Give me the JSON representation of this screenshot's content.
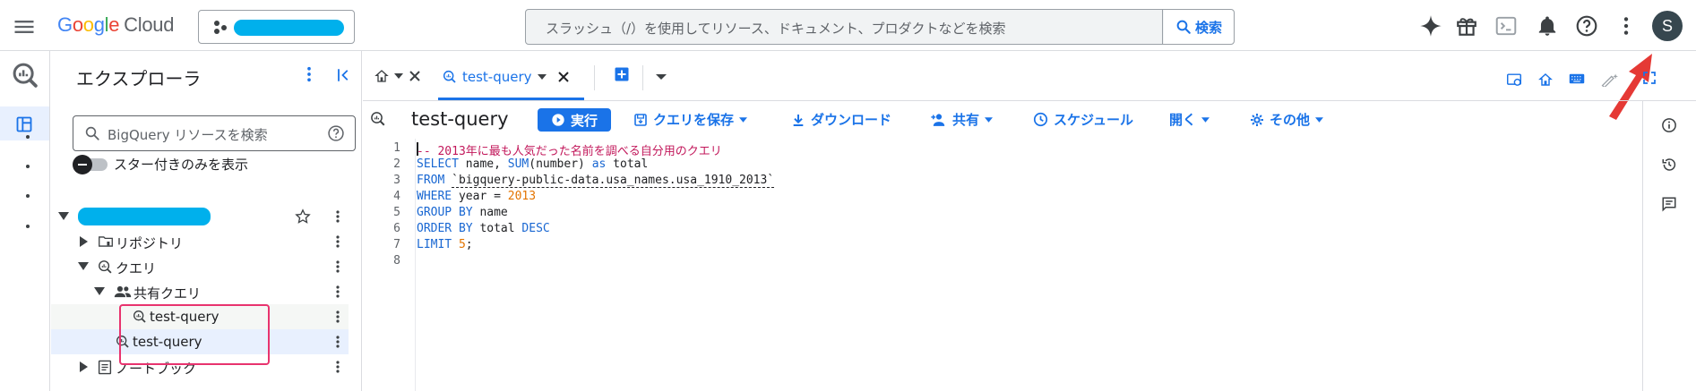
{
  "header": {
    "logo_letters": [
      "G",
      "o",
      "o",
      "g",
      "l",
      "e"
    ],
    "logo_suffix": "Cloud",
    "search_placeholder": "スラッシュ（/）を使用してリソース、ドキュメント、プロダクトなどを検索",
    "search_button": "検索",
    "avatar_initial": "S"
  },
  "explorer": {
    "title": "エクスプローラ",
    "search_placeholder": "BigQuery リソースを検索",
    "star_toggle_label": "スター付きのみを表示",
    "tree": {
      "repository": "リポジトリ",
      "queries": "クエリ",
      "shared_queries": "共有クエリ",
      "shared_query_item": "test-query",
      "query_item": "test-query",
      "notebook": "ノートブック"
    }
  },
  "tabs": {
    "active_tab": "test-query"
  },
  "query": {
    "title": "test-query",
    "run": "実行",
    "save": "クエリを保存",
    "download": "ダウンロード",
    "share": "共有",
    "schedule": "スケジュール",
    "open": "開く",
    "more": "その他"
  },
  "editor": {
    "line_numbers": [
      "1",
      "2",
      "3",
      "4",
      "5",
      "6",
      "7",
      "8"
    ],
    "lines": {
      "l1": "-- 2013年に最も人気だった名前を調べる自分用のクエリ",
      "l2_kw1": "SELECT",
      "l2_a": " name, ",
      "l2_fn": "SUM",
      "l2_b": "(number) ",
      "l2_kw2": "as",
      "l2_c": " total",
      "l3_kw": "FROM",
      "l3_sp": " ",
      "l3_str": "`bigquery-public-data.usa_names.usa_1910_2013`",
      "l4_kw": "WHERE",
      "l4_a": " year = ",
      "l4_num": "2013",
      "l5_kw": "GROUP BY",
      "l5_a": " name",
      "l6_kw1": "ORDER BY",
      "l6_a": " total ",
      "l6_kw2": "DESC",
      "l7_kw": "LIMIT",
      "l7_sp": " ",
      "l7_num": "5",
      "l7_end": ";"
    }
  },
  "colors": {
    "accent": "#1a73e8",
    "redaction": "#00b0ec",
    "highlight_box": "#e8336e",
    "annotation_arrow": "#e53935"
  }
}
